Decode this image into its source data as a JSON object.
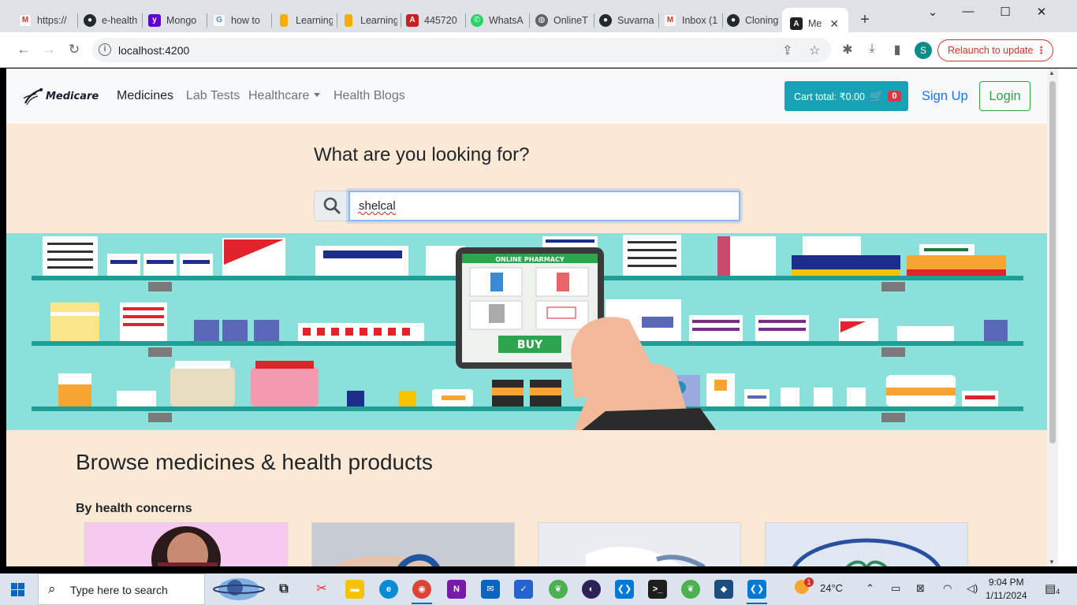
{
  "browser": {
    "tabs": [
      {
        "title": "https://",
        "icon": "gmail-icon",
        "color": "#d93025"
      },
      {
        "title": "e-health",
        "icon": "github-icon",
        "color": "#24292f"
      },
      {
        "title": "Mongo",
        "icon": "yahoo-icon",
        "color": "#6001d2"
      },
      {
        "title": "how to",
        "icon": "google-icon",
        "color": "#4285f4"
      },
      {
        "title": "Learning",
        "icon": "analytics-icon",
        "color": "#f9ab00"
      },
      {
        "title": "Learning",
        "icon": "analytics-icon",
        "color": "#f9ab00"
      },
      {
        "title": "445720",
        "icon": "pdf-icon",
        "color": "#c5221f"
      },
      {
        "title": "WhatsA",
        "icon": "whatsapp-icon",
        "color": "#25d366"
      },
      {
        "title": "OnlineT",
        "icon": "globe-icon",
        "color": "#5f6368"
      },
      {
        "title": "Suvarna",
        "icon": "github-icon",
        "color": "#24292f"
      },
      {
        "title": "Inbox (1",
        "icon": "gmail-icon",
        "color": "#d93025"
      },
      {
        "title": "Cloning",
        "icon": "github-icon",
        "color": "#24292f"
      },
      {
        "title": "Me",
        "icon": "angular-icon",
        "color": "#202124"
      }
    ],
    "url": "localhost:4200",
    "profile_initial": "S",
    "relaunch_label": "Relaunch to update"
  },
  "site": {
    "brand": "Medicare",
    "nav": {
      "medicines": "Medicines",
      "lab_tests": "Lab Tests",
      "healthcare": "Healthcare",
      "health_blogs": "Health Blogs"
    },
    "cart": {
      "label": "Cart total: ₹0.00",
      "count": "0"
    },
    "signup": "Sign Up",
    "login": "Login"
  },
  "search": {
    "title": "What are you looking for?",
    "value": "shelcal"
  },
  "banner": {
    "header": "ONLINE PHARMACY",
    "buy": "BUY"
  },
  "browse": {
    "title": "Browse medicines & health products",
    "concern_title": "By health concerns"
  },
  "taskbar": {
    "search_placeholder": "Type here to search",
    "weather_temp": "24°C",
    "weather_badge": "1",
    "time": "9:04 PM",
    "date": "1/11/2024",
    "notification_count": "4"
  },
  "colors": {
    "accent_cart": "#17a2b8",
    "cart_badge": "#dc3545",
    "login_green": "#28a745",
    "page_bg": "#fbe9d6",
    "banner_bg": "#8be0dc"
  }
}
